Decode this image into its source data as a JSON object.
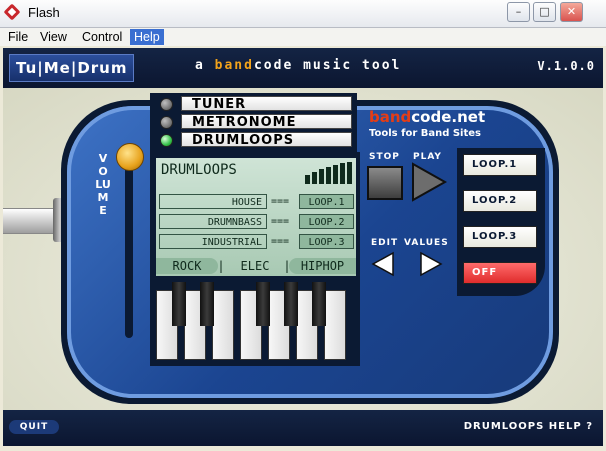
{
  "window": {
    "title": "Flash",
    "minimize": "–",
    "maximize": "□",
    "close": "✕"
  },
  "menu": [
    "File",
    "View",
    "Control",
    "Help"
  ],
  "header": {
    "logo": "Tu|Me|Drum",
    "tagline_prefix": "a ",
    "tagline_brand": "band",
    "tagline_suffix": "code music tool",
    "version": "V.1.0.0"
  },
  "volume_label": "VOLUME",
  "modes": [
    {
      "label": "TUNER",
      "active": false
    },
    {
      "label": "METRONOME",
      "active": false
    },
    {
      "label": "DRUMLOOPS",
      "active": true
    }
  ],
  "lcd": {
    "title": "DRUMLOOPS",
    "genres": [
      {
        "name": "HOUSE",
        "sep": "===",
        "loop": "LOOP.1"
      },
      {
        "name": "DRUMNBASS",
        "sep": "===",
        "loop": "LOOP.2"
      },
      {
        "name": "INDUSTRIAL",
        "sep": "===",
        "loop": "LOOP.3"
      }
    ],
    "styles": [
      "ROCK",
      "ELEC",
      "HIPHOP"
    ],
    "style_sep": "|"
  },
  "brand": {
    "name_hl": "band",
    "name_rest": "code.net",
    "sub": "Tools for Band Sites"
  },
  "transport": {
    "stop": "STOP",
    "play": "PLAY",
    "edit": "EDIT",
    "values": "VALUES"
  },
  "loops": [
    "LOOP.1",
    "LOOP.2",
    "LOOP.3"
  ],
  "off_label": "OFF",
  "footer": {
    "quit": "QUIT",
    "help": "DRUMLOOPS HELP  ?"
  },
  "colors": {
    "accent": "#f2a31b",
    "brand_red": "#e53d16",
    "lcd": "#b9d6c3",
    "device": "#1b4591",
    "led_on": "#35c24a"
  }
}
